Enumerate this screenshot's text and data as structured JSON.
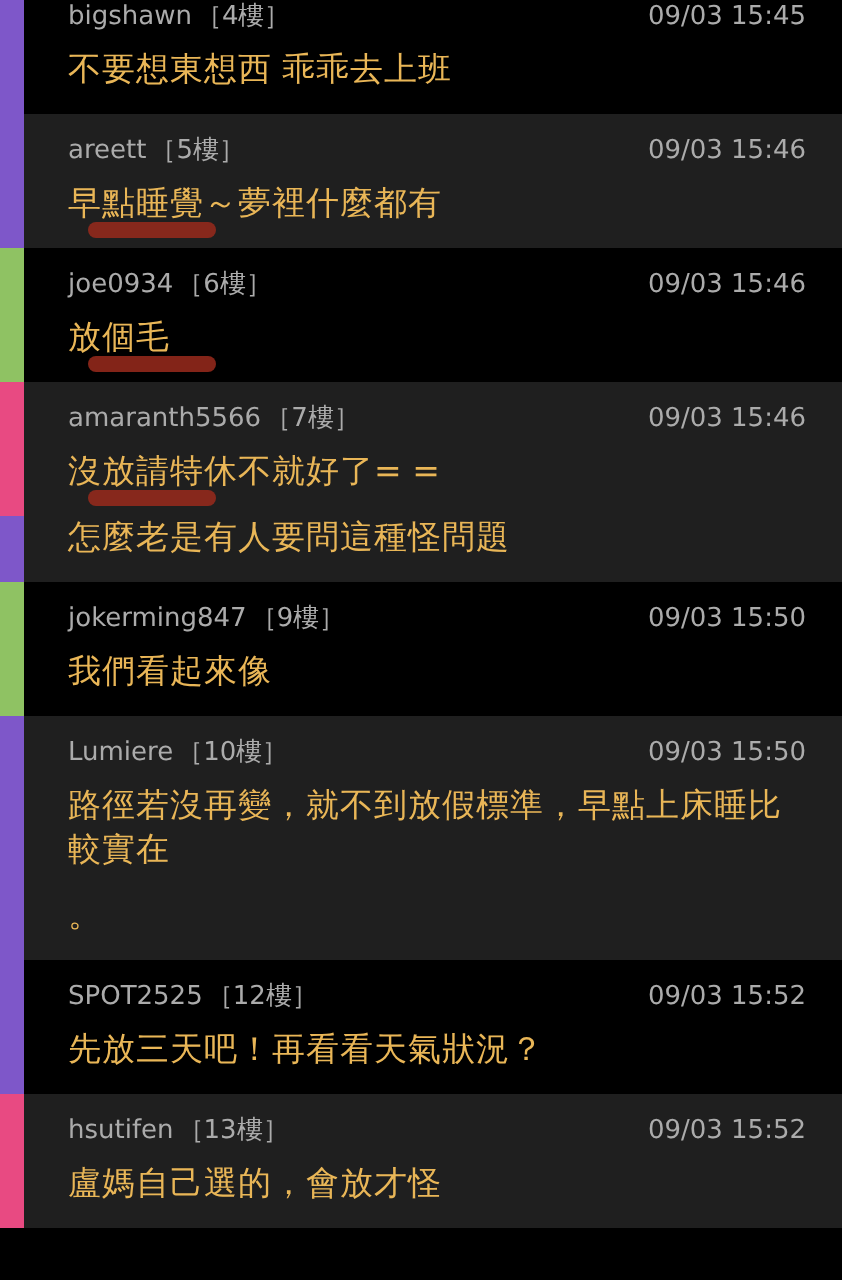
{
  "comments": [
    {
      "author": "bigshawn",
      "floor": "［4樓］",
      "time": "09/03 15:45",
      "lines": [
        {
          "text": "不要想東想西 乖乖去上班",
          "color": "#7e57c9",
          "scribbled": false
        }
      ]
    },
    {
      "author": "areett",
      "floor": "［5樓］",
      "time": "09/03 15:46",
      "lines": [
        {
          "text": "早點睡覺～夢裡什麼都有",
          "color": "#7e57c9",
          "scribbled": true
        }
      ]
    },
    {
      "author": "joe0934",
      "floor": "［6樓］",
      "time": "09/03 15:46",
      "lines": [
        {
          "text": "放個毛",
          "color": "#8fc263",
          "scribbled": true
        }
      ]
    },
    {
      "author": "amaranth5566",
      "floor": "［7樓］",
      "time": "09/03 15:46",
      "lines": [
        {
          "text": "沒放請特休不就好了= =",
          "color": "#e84a82",
          "scribbled": true
        },
        {
          "text": "怎麼老是有人要問這種怪問題",
          "color": "#7e57c9",
          "scribbled": false
        }
      ]
    },
    {
      "author": "jokerming847",
      "floor": "［9樓］",
      "time": "09/03 15:50",
      "lines": [
        {
          "text": "我們看起來像",
          "color": "#8fc263",
          "scribbled": false
        }
      ]
    },
    {
      "author": "Lumiere",
      "floor": "［10樓］",
      "time": "09/03 15:50",
      "lines": [
        {
          "text": "路徑若沒再變，就不到放假標準，早點上床睡比較實在",
          "color": "#7e57c9",
          "scribbled": false
        },
        {
          "text": "。",
          "color": "#7e57c9",
          "scribbled": false
        }
      ]
    },
    {
      "author": "SPOT2525",
      "floor": "［12樓］",
      "time": "09/03 15:52",
      "lines": [
        {
          "text": "先放三天吧！再看看天氣狀況？",
          "color": "#7e57c9",
          "scribbled": false
        }
      ]
    },
    {
      "author": "hsutifen",
      "floor": "［13樓］",
      "time": "09/03 15:52",
      "lines": [
        {
          "text": "盧媽自己選的，會放才怪",
          "color": "#e84a82",
          "scribbled": false
        }
      ]
    }
  ]
}
